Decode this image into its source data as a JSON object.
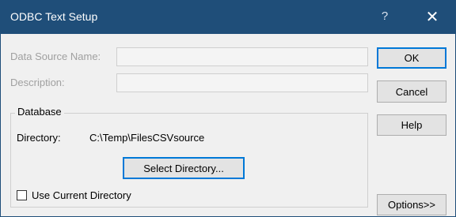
{
  "window": {
    "title": "ODBC Text Setup",
    "help_glyph": "?",
    "close_glyph": "✕"
  },
  "fields": {
    "data_source_name": {
      "label": "Data Source Name:",
      "value": ""
    },
    "description": {
      "label": "Description:",
      "value": ""
    }
  },
  "buttons": {
    "ok": "OK",
    "cancel": "Cancel",
    "help": "Help",
    "options": "Options>>",
    "select_directory": "Select Directory..."
  },
  "database": {
    "group_label": "Database",
    "directory_label": "Directory:",
    "directory_value": "C:\\Temp\\FilesCSVsource",
    "use_current_directory_label": "Use Current Directory",
    "use_current_directory_checked": false
  }
}
